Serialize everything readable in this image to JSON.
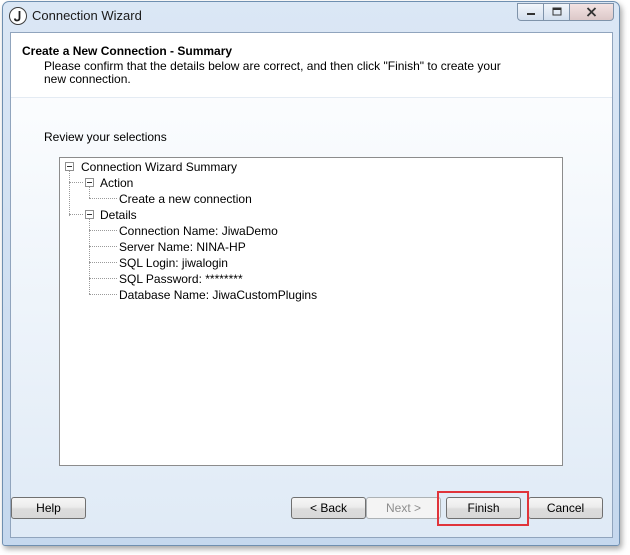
{
  "window": {
    "title": "Connection Wizard",
    "icon": "jiwa-j-icon"
  },
  "header": {
    "title": "Create a New Connection - Summary",
    "description": "Please confirm that the details below are correct, and then click \"Finish\" to create your new connection."
  },
  "review_label": "Review your selections",
  "tree": {
    "root": "Connection Wizard Summary",
    "action_label": "Action",
    "action_value": "Create a new connection",
    "details_label": "Details",
    "details": [
      "Connection Name: JiwaDemo",
      "Server Name: NINA-HP",
      "SQL Login: jiwalogin",
      "SQL Password: ********",
      "Database Name: JiwaCustomPlugins"
    ]
  },
  "buttons": {
    "help": "Help",
    "back": "< Back",
    "next": "Next >",
    "finish": "Finish",
    "cancel": "Cancel"
  },
  "colors": {
    "highlight": "#e0343b",
    "window_border": "#6f8fb0"
  }
}
